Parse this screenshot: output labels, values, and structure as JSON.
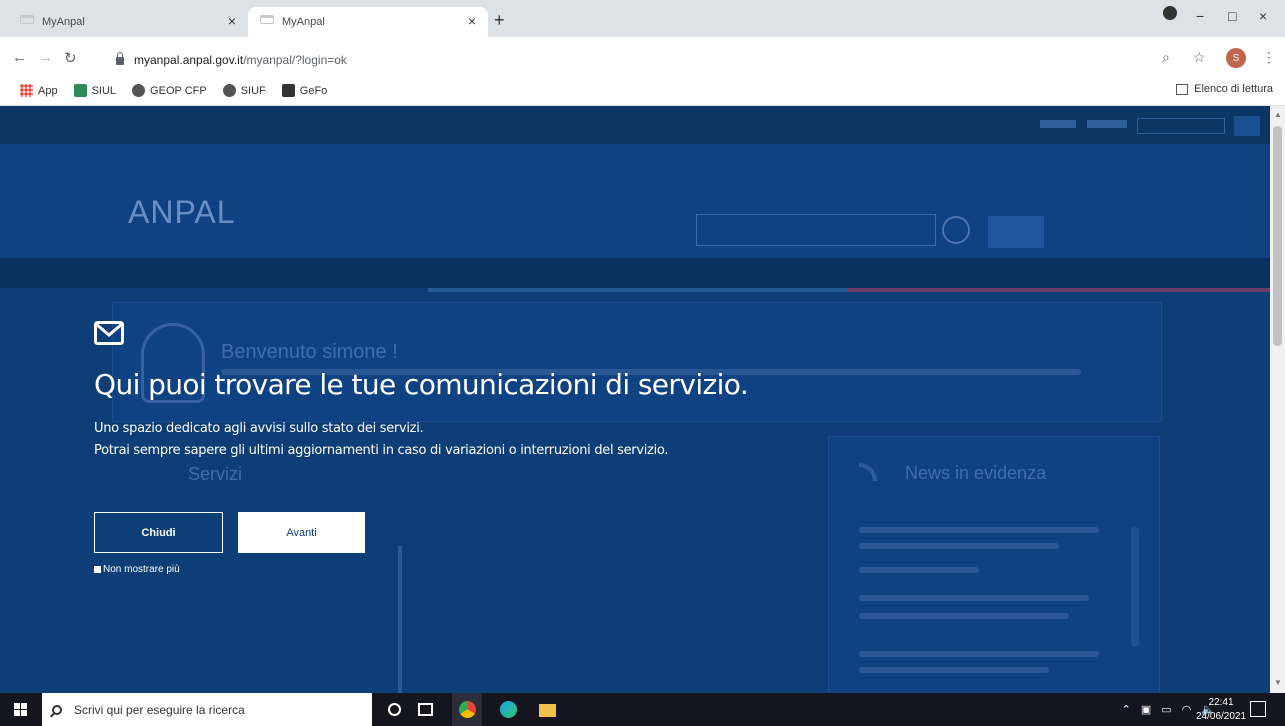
{
  "browser": {
    "tabs": [
      {
        "title": "MyAnpal",
        "close": "×"
      },
      {
        "title": "MyAnpal",
        "close": "×"
      }
    ],
    "new_tab": "+",
    "window_controls": {
      "minimize": "−",
      "maximize": "□",
      "close": "×"
    },
    "url_host": "myanpal.anpal.gov.it",
    "url_path": "/myanpal/?login=ok",
    "profile_initial": "S",
    "bookmarks": [
      {
        "label": "App",
        "icon": "apps-grid-icon",
        "color": "#f4b400"
      },
      {
        "label": "SIUL",
        "icon": "siul-icon",
        "color": "#2e8b57"
      },
      {
        "label": "GEOP CFP",
        "icon": "globe-icon",
        "color": "#555555"
      },
      {
        "label": "SIUF",
        "icon": "globe-icon",
        "color": "#555555"
      },
      {
        "label": "GeFo",
        "icon": "gefo-icon",
        "color": "#333333"
      }
    ],
    "reading_list": "Elenco di lettura"
  },
  "site": {
    "welcome": "Benvenuto simone !",
    "news_title": "News in evidenza",
    "services_title": "Servizi"
  },
  "overlay": {
    "title": "Qui puoi trovare le tue comunicazioni di servizio.",
    "line1": "Uno spazio dedicato agli avvisi sullo stato dei servizi.",
    "line2": "Potrai sempre sapere gli ultimi aggiornamenti in caso di variazioni o interruzioni del servizio.",
    "close_button": "Chiudi",
    "next_button": "Avanti",
    "dont_show": "Non mostrare più"
  },
  "taskbar": {
    "search_placeholder": "Scrivi qui per eseguire la ricerca",
    "time": "22:41",
    "date": "24/06/2021",
    "notifications": "5"
  },
  "colors": {
    "page_dim": "#0d3e77",
    "taskbar": "#15151f",
    "chrome_tabbar": "#dee1e6"
  }
}
